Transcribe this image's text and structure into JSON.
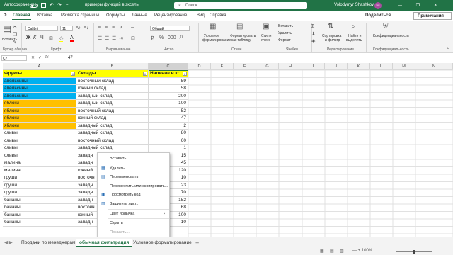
{
  "titlebar": {
    "autosave": "Автосохранение",
    "qat": "= ",
    "filename": "примеры функций в эксель",
    "search": "Поиск",
    "user": "Volodymyr Shashkov",
    "avatar": "VS",
    "window_controls": "— ❐ ✕",
    "autosave_on": false
  },
  "menu": {
    "items": [
      "Ф",
      "Главная",
      "Вставка",
      "Разметка страницы",
      "Формулы",
      "Данные",
      "Рецензирование",
      "Вид",
      "Справка"
    ],
    "active": "Главная",
    "share": "Поделиться",
    "notes": "Примечания"
  },
  "ribbon": {
    "clipboard": {
      "paste": "Вставить",
      "label": "Буфер обмена"
    },
    "font": {
      "name": "Calibri",
      "size": "11",
      "label": "Шрифт",
      "bold": "Ж",
      "italic": "К",
      "underline": "Ч"
    },
    "alignment": {
      "label": "Выравнивание"
    },
    "number": {
      "format": "Общий",
      "label": "Число"
    },
    "styles": {
      "conditional": "Условное",
      "conditional2": "форматирование",
      "table": "Форматировать",
      "table2": "как таблицу",
      "cell": "Стили",
      "cell2": "ячеек",
      "label": "Стили"
    },
    "cells": {
      "insert": "Вставить",
      "delete": "Удалить",
      "format": "Формат",
      "label": "Ячейки"
    },
    "editing": {
      "sort": "Сортировка",
      "sort2": "и фильтр",
      "find": "Найти и",
      "find2": "выделить",
      "label": "Редактирование"
    },
    "sensitivity": {
      "title": "Конфиденциальность",
      "label": "Конфиденциальность"
    }
  },
  "formula_bar": {
    "cell": "C7",
    "cancel": "✕",
    "enter": "✓",
    "fx": "fx",
    "value": "47"
  },
  "columns": [
    "A",
    "B",
    "C",
    "D",
    "E",
    "F",
    "G",
    "H",
    "I",
    "J",
    "K",
    "L",
    "M",
    "N"
  ],
  "table": {
    "headers": [
      "Фрукты",
      "Склады",
      "Наличие в кг"
    ],
    "rows": [
      [
        "апельсины",
        "восточный склад",
        "59",
        "blue"
      ],
      [
        "апельсины",
        "южный склад",
        "58",
        "blue"
      ],
      [
        "апельсины",
        "западный склад",
        "200",
        "blue"
      ],
      [
        "яблоки",
        "западный склад",
        "100",
        "orange"
      ],
      [
        "яблоки",
        "восточный склад",
        "52",
        "orange"
      ],
      [
        "яблоки",
        "южный склад",
        "47",
        "orange"
      ],
      [
        "яблоки",
        "западный склад",
        "2",
        "orange"
      ],
      [
        "сливы",
        "западный склад",
        "80",
        ""
      ],
      [
        "сливы",
        "восточный склад",
        "60",
        ""
      ],
      [
        "сливы",
        "западный склад",
        "1",
        ""
      ],
      [
        "сливы",
        "западн",
        "15",
        ""
      ],
      [
        "малина",
        "западн",
        "45",
        ""
      ],
      [
        "малина",
        "южный",
        "120",
        ""
      ],
      [
        "груши",
        "восточн",
        "10",
        ""
      ],
      [
        "груши",
        "западн",
        "23",
        ""
      ],
      [
        "груши",
        "западн",
        "70",
        ""
      ],
      [
        "бананы",
        "западн",
        "152",
        ""
      ],
      [
        "бананы",
        "восточн",
        "68",
        ""
      ],
      [
        "бананы",
        "южный",
        "100",
        ""
      ],
      [
        "бананы",
        "западн",
        "10",
        ""
      ]
    ]
  },
  "context_menu": {
    "items": [
      {
        "label": "Вставить...",
        "icon": "",
        "disabled": false
      },
      {
        "label": "Удалить",
        "icon": "▦",
        "disabled": false
      },
      {
        "label": "Переименовать",
        "icon": "▤",
        "disabled": false
      },
      {
        "label": "Переместить или скопировать...",
        "icon": "",
        "disabled": false
      },
      {
        "label": "Просмотреть код",
        "icon": "▣",
        "disabled": false
      },
      {
        "label": "Защитить лист...",
        "icon": "▥",
        "disabled": false
      },
      {
        "label": "Цвет ярлычка",
        "icon": "",
        "disabled": false,
        "submenu": "›"
      },
      {
        "label": "Скрыть",
        "icon": "",
        "disabled": false
      },
      {
        "label": "Показать...",
        "icon": "",
        "disabled": true
      },
      {
        "label": "Выделить все листы",
        "icon": "",
        "disabled": false
      }
    ]
  },
  "sheets": {
    "tabs": [
      "Продажи по менеджерам",
      "обычная фильтрация",
      "Условное форматирование"
    ],
    "active": 1,
    "add": "+",
    "nav": "◀ ▶"
  },
  "status": {
    "zoom_text": "—  + 100%",
    "zoom_pct": 100
  },
  "colors": {
    "accent": "#217346",
    "blue_fill": "#00b0f0",
    "orange_fill": "#ffc000",
    "header_fill": "#ffff00"
  }
}
